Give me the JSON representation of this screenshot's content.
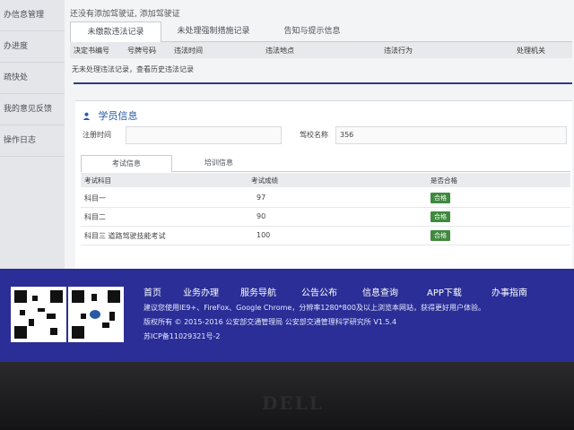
{
  "sidebar": {
    "items": [
      {
        "label": "办信息管理"
      },
      {
        "label": "办进度"
      },
      {
        "label": "疏快处"
      },
      {
        "label": "我的意见反馈"
      },
      {
        "label": "操作日志"
      }
    ]
  },
  "notice": "还没有添加驾驶证, 添加驾驶证",
  "violation": {
    "tabs": [
      "未缴款违法记录",
      "未处理强制措施记录",
      "告知与提示信息"
    ],
    "columns": [
      "决定书编号",
      "号牌号码",
      "违法时间",
      "违法地点",
      "违法行为",
      "处理机关"
    ],
    "empty_text": "无未处理违法记录，查看历史违法记录"
  },
  "student": {
    "title": "学员信息",
    "register_label": "注册时间",
    "register_value": "",
    "school_label": "驾校名称",
    "school_value": "356",
    "tabs": [
      "考试信息",
      "培训信息"
    ],
    "columns": [
      "考试科目",
      "考试成绩",
      "是否合格"
    ],
    "rows": [
      {
        "subject": "科目一",
        "score": "97",
        "status": "合格"
      },
      {
        "subject": "科目二",
        "score": "90",
        "status": "合格"
      },
      {
        "subject": "科目三 道路驾驶技能考试",
        "score": "100",
        "status": "合格"
      }
    ]
  },
  "footer": {
    "nav": [
      "首页",
      "业务办理",
      "服务导航",
      "公告公布",
      "信息查询",
      "APP下载",
      "办事指南"
    ],
    "browser_note": "建议您使用IE9+、FireFox、Google Chrome，分辨率1280*800及以上浏览本网站，获得更好用户体验。",
    "copyright": "版权所有 © 2015-2016 公安部交通管理局 公安部交通管理科学研究所 V1.5.4",
    "icp": "苏ICP备11029321号-2"
  },
  "device": {
    "brand": "DELL"
  },
  "colors": {
    "footer_bg": "#2a2e96",
    "pass_badge": "#3f8a3f",
    "accent_blue": "#2f3a8f"
  }
}
